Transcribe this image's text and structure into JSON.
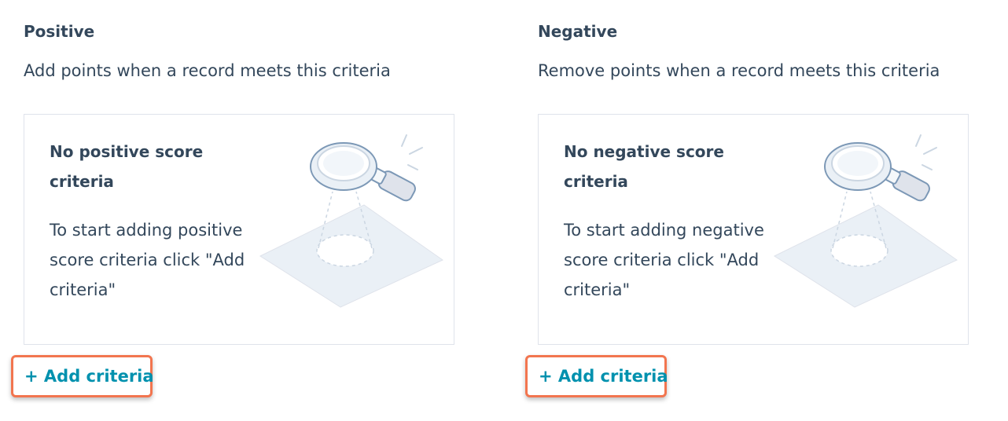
{
  "positive": {
    "title": "Positive",
    "description": "Add points when a record meets this criteria",
    "card_title": "No positive score criteria",
    "card_body": "To start adding positive score criteria click \"Add criteria\"",
    "illustration_icon": "magnifying-glass-icon",
    "add_label": "+ Add criteria"
  },
  "negative": {
    "title": "Negative",
    "description": "Remove points when a record meets this criteria",
    "card_title": "No negative score criteria",
    "card_body": "To start adding negative score criteria click \"Add criteria\"",
    "illustration_icon": "magnifying-glass-icon",
    "add_label": "+ Add criteria"
  },
  "colors": {
    "text": "#33475b",
    "link": "#0091ae",
    "highlight": "#f2754f",
    "card_border": "#dfe3eb"
  }
}
